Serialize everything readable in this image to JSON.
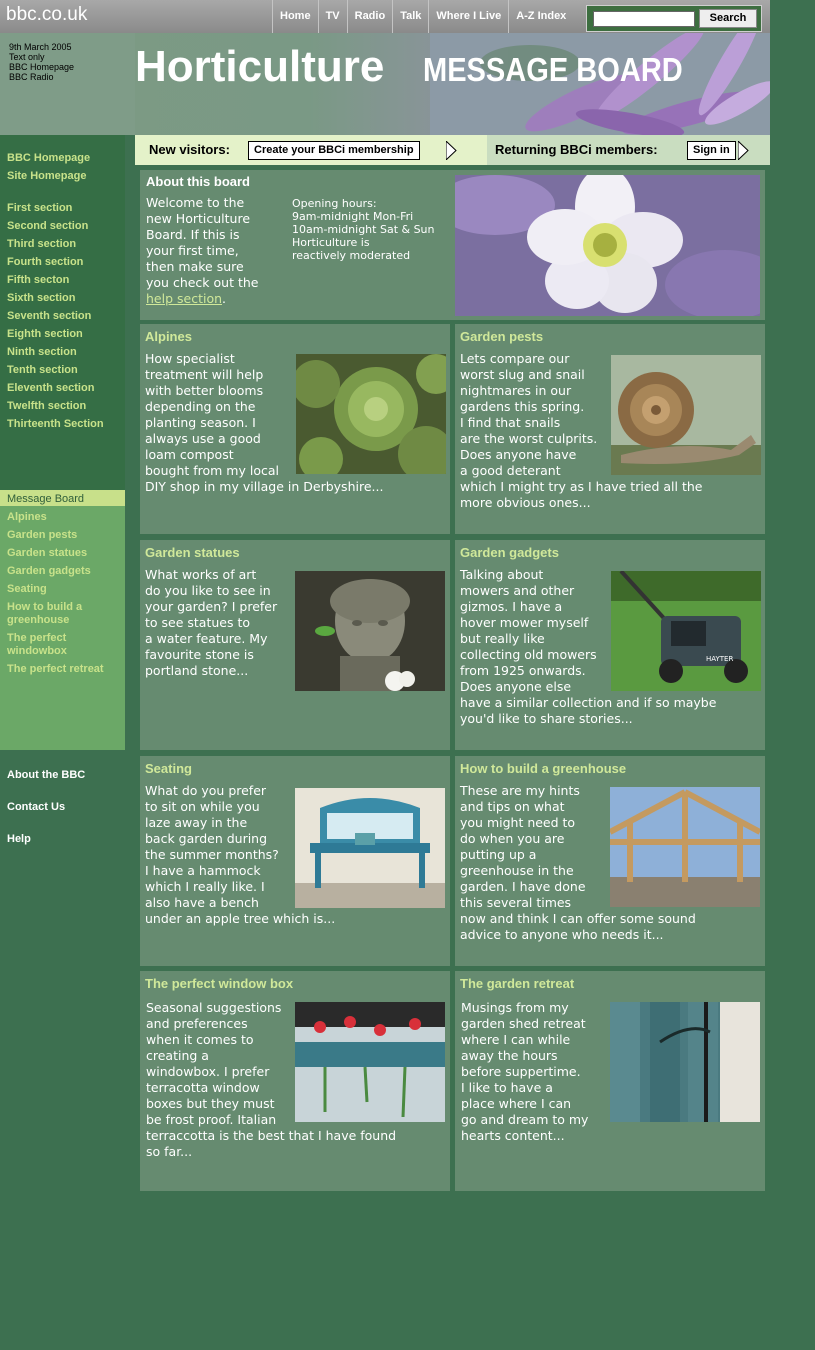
{
  "topbar": {
    "logo": "bbc.co.uk",
    "nav": [
      "Home",
      "TV",
      "Radio",
      "Talk",
      "Where I Live",
      "A-Z Index"
    ],
    "search_button": "Search",
    "search_value": ""
  },
  "banner": {
    "date": "9th March 2005",
    "links": [
      "Text only",
      "BBC Homepage",
      "BBC Radio"
    ],
    "title_main": "Horticulture",
    "title_sub": "MESSAGE BOARD"
  },
  "sidebar": {
    "top_links": [
      "BBC Homepage",
      "Site Homepage"
    ],
    "sections": [
      "First section",
      "Second section",
      "Third section",
      "Fourth section",
      "Fifth secton",
      "Sixth section",
      "Seventh section",
      "Eighth section",
      "Ninth section",
      "Tenth section",
      "Eleventh section",
      "Twelfth section",
      "Thirteenth Section"
    ],
    "board_current": "Message Board",
    "board_links": [
      "Alpines",
      "Garden pests",
      "Garden statues",
      "Garden gadgets",
      "Seating",
      "How to build a",
      "greenhouse",
      "The perfect",
      "windowbox",
      "The perfect retreat"
    ],
    "footer_links": [
      "About the BBC",
      "Contact Us",
      "Help"
    ]
  },
  "visitors": {
    "new_label": "New visitors:",
    "new_button": "Create your BBCi membership",
    "returning_label": "Returning BBCi members:",
    "returning_button": "Sign in"
  },
  "about": {
    "title": "About this board",
    "text_lines": [
      "Welcome to the",
      "new Horticulture",
      "Board. If this is",
      "your first time,",
      "then make sure",
      "you check out the"
    ],
    "link": "help section",
    "link_suffix": ".",
    "hours_lines": [
      "Opening hours:",
      "9am-midnight Mon-Fri",
      "10am-midnight Sat & Sun",
      "Horticulture is",
      "reactively moderated"
    ]
  },
  "boards": [
    {
      "title": "Alpines",
      "lines": [
        "How specialist",
        "treatment will help",
        "with better blooms",
        "depending on the",
        "planting season. I",
        "always use a good",
        "loam compost",
        "bought from my local",
        "DIY shop in my village in Derbyshire..."
      ]
    },
    {
      "title": "Garden pests",
      "lines": [
        "Lets compare our",
        "worst slug and snail",
        "nightmares in our",
        "gardens this spring.",
        "I find that snails",
        "are the worst culprits.",
        "Does anyone have",
        "a good deterant",
        "which I might try as I have tried all the",
        "more obvious ones..."
      ]
    },
    {
      "title": "Garden statues",
      "lines": [
        "What works of art",
        "do you like to see in",
        "your garden? I prefer",
        "to see statues to",
        "a water feature. My",
        "favourite stone is",
        "portland stone..."
      ]
    },
    {
      "title": "Garden gadgets",
      "lines": [
        "Talking about",
        "mowers and other",
        "gizmos. I have a",
        "hover mower myself",
        "but really like",
        "collecting old mowers",
        "from 1925 onwards.",
        "Does anyone else",
        "have a similar collection and if so maybe",
        "you'd like to share stories..."
      ]
    },
    {
      "title": "Seating",
      "lines": [
        "What do you prefer",
        "to sit on while you",
        "laze away in the",
        "back garden during",
        "the summer months?",
        "I have a hammock",
        "which I really like. I",
        "also have a bench",
        "under an apple tree which is..."
      ]
    },
    {
      "title": "How to build a greenhouse",
      "lines": [
        "These are my hints",
        "and tips on what",
        "you might need to",
        "do when you are",
        "putting up a",
        "greenhouse in the",
        "garden. I have done",
        "this several times",
        "now and think I can offer some sound",
        "advice to anyone who needs it..."
      ]
    },
    {
      "title": "The perfect window box",
      "lines": [
        "Seasonal suggestions",
        "and preferences",
        "when it comes to",
        "creating a",
        "windowbox. I prefer",
        "terracotta window",
        "boxes but they must",
        "be frost proof. Italian",
        "terraccotta is the best that I have found",
        "so far..."
      ]
    },
    {
      "title": "The garden retreat",
      "lines": [
        "Musings from my",
        "garden shed retreat",
        "where I can while",
        "away the hours",
        "before suppertime.",
        "I like to have a",
        "place where I can",
        "go and dream to my",
        "hearts content..."
      ]
    }
  ],
  "mower_brand": "HAYTER",
  "colors": {
    "accent_green": "#c8e28a",
    "panel": "#668b70",
    "background": "#3d7050"
  }
}
